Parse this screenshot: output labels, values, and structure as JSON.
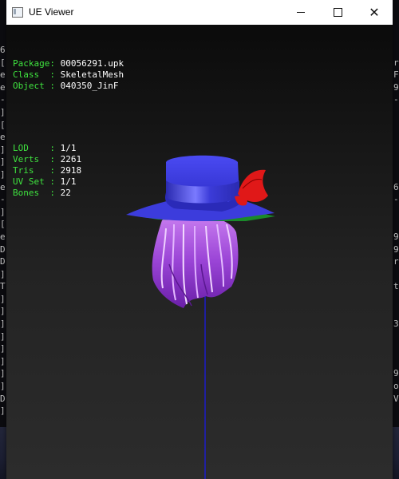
{
  "background": {
    "left_strip": [
      "6",
      "[",
      "e",
      "e",
      "-",
      "]",
      "[",
      "e",
      "]",
      "]",
      "]",
      "e",
      "-",
      "]",
      "[",
      "e",
      "D",
      "D",
      "]",
      "T",
      "]",
      "]",
      "]",
      "]",
      "]",
      "]",
      "]",
      "]",
      "D",
      "]",
      "e",
      "]"
    ],
    "right_strip": [
      "",
      "r",
      "F",
      "9",
      "-",
      "",
      "",
      "",
      "",
      "",
      "",
      "6",
      "-",
      "",
      "",
      "9",
      "9",
      "r",
      "",
      "t",
      "",
      "",
      "3",
      "",
      "",
      "",
      "9",
      "o",
      "V"
    ]
  },
  "window": {
    "title": "UE Viewer",
    "controls": {
      "minimize": "minimize",
      "maximize": "maximize",
      "close": "✕"
    }
  },
  "info": {
    "rows": [
      {
        "label": "Package:",
        "value": "00056291.upk"
      },
      {
        "label": "Class  :",
        "value": "SkeletalMesh"
      },
      {
        "label": "Object :",
        "value": "040350_JinF"
      }
    ],
    "stats": [
      {
        "label": "LOD    :",
        "value": "1/1"
      },
      {
        "label": "Verts  :",
        "value": "2261"
      },
      {
        "label": "Tris   :",
        "value": "2918"
      },
      {
        "label": "UV Set :",
        "value": "1/1"
      },
      {
        "label": "Bones  :",
        "value": "22"
      }
    ]
  },
  "colors": {
    "label_green": "#3fe33f",
    "hat_blue": "#3a3ae6",
    "feather_red": "#e01818",
    "hair_purple": "#9b4fd6",
    "axis_blue": "#1c1cc8"
  }
}
